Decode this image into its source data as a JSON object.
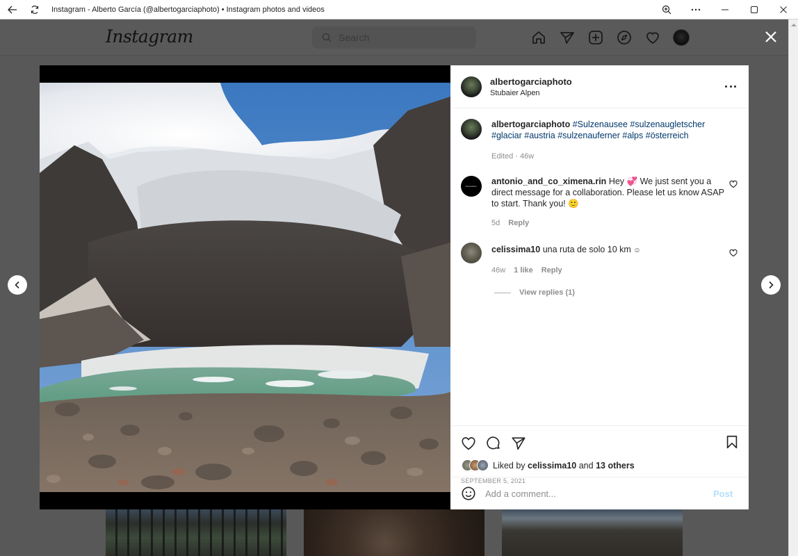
{
  "window": {
    "title": "Instagram - Alberto García (@albertogarciaphoto) • Instagram photos and videos",
    "icons": [
      "back-arrow-icon",
      "refresh-icon",
      "zoom-icon",
      "more-icon",
      "minimize-icon",
      "maximize-icon",
      "close-icon"
    ]
  },
  "header": {
    "logo": "Instagram",
    "search_placeholder": "Search",
    "nav_icons": [
      "home-icon",
      "direct-icon",
      "new-post-icon",
      "explore-icon",
      "activity-heart-icon",
      "profile-avatar"
    ]
  },
  "post": {
    "username": "albertogarciaphoto",
    "location": "Stubaier Alpen",
    "caption": {
      "username": "albertogarciaphoto",
      "hashtags": [
        "#Sulzenausee",
        "#sulzenaugletscher",
        "#glaciar",
        "#austria",
        "#sulzenauferner",
        "#alps",
        "#österreich"
      ],
      "edited_label": "Edited",
      "age": "46w"
    },
    "comments": [
      {
        "username": "antonio_and_co_ximena.rin",
        "text_before_emoji": "Hey",
        "emoji1": "💞",
        "text_after_emoji": "We just sent you a direct message for a collaboration. Please let us know ASAP to start. Thank you!",
        "emoji2": "🙂",
        "age": "5d",
        "reply_label": "Reply",
        "avatar_text": "Antonio&Co."
      },
      {
        "username": "celissima10",
        "text": "una ruta de solo 10 km",
        "emoji": "☺",
        "age": "46w",
        "likes": "1 like",
        "reply_label": "Reply",
        "view_replies": "View replies (1)"
      }
    ],
    "liked_by": {
      "prefix": "Liked by",
      "user": "celissima10",
      "conjunction": "and",
      "others": "13 others"
    },
    "date": "SEPTEMBER 5, 2021",
    "add_comment_placeholder": "Add a comment...",
    "post_button": "Post"
  },
  "colors": {
    "hashtag": "#00376b",
    "post_button_disabled": "#b2dffc",
    "secondary_text": "#8e8e8e",
    "overlay": "#585858"
  }
}
